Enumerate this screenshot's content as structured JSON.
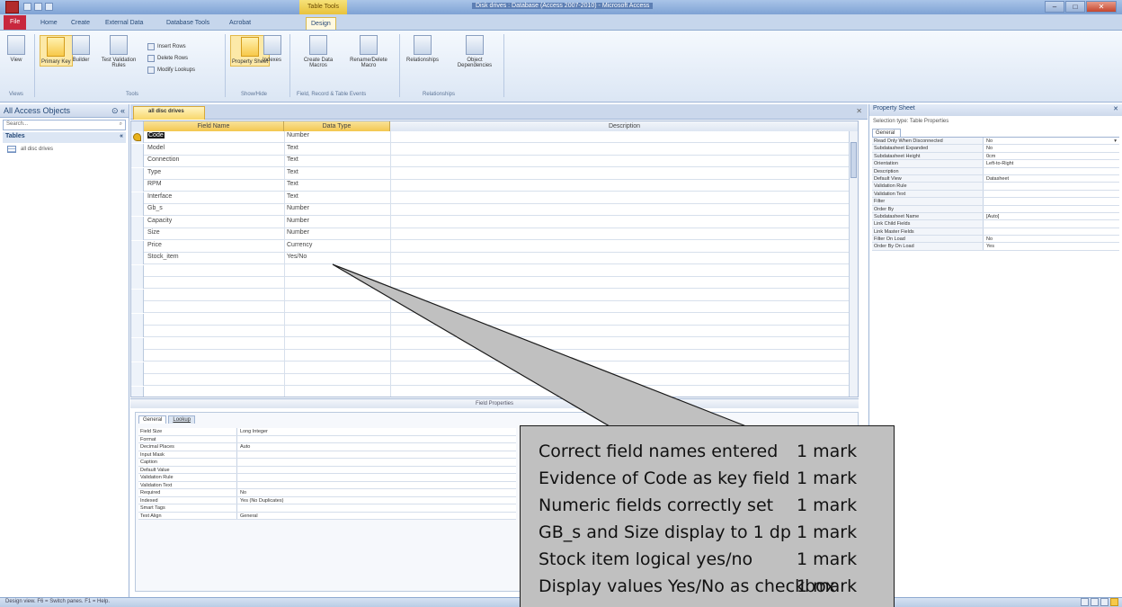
{
  "window": {
    "title": "Disk drives : Database (Access 2007-2010) - Microsoft Access",
    "context_tab_header": "Table Tools",
    "controls": {
      "minimize": "–",
      "maximize": "□",
      "close": "✕"
    }
  },
  "ribbon": {
    "tabs": [
      "File",
      "Home",
      "Create",
      "External Data",
      "Database Tools",
      "Acrobat",
      "Design"
    ],
    "active_tab": "Design",
    "buttons": {
      "view": "View",
      "primary_key": "Primary Key",
      "builder": "Builder",
      "test_validation": "Test Validation Rules",
      "insert_rows": "Insert Rows",
      "delete_rows": "Delete Rows",
      "modify_lookups": "Modify Lookups",
      "property_sheet": "Property Sheet",
      "indexes": "Indexes",
      "create_data_macros": "Create Data Macros",
      "rename_delete_macro": "Rename/Delete Macro",
      "relationships": "Relationships",
      "object_dependencies": "Object Dependencies"
    },
    "groups": [
      "Views",
      "Tools",
      "Show/Hide",
      "Field, Record & Table Events",
      "Relationships"
    ]
  },
  "nav_pane": {
    "header": "All Access Objects",
    "search_placeholder": "Search...",
    "group": "Tables",
    "items": [
      "all disc drives"
    ]
  },
  "document": {
    "tab_label": "all disc drives",
    "columns": [
      "Field Name",
      "Data Type",
      "Description"
    ],
    "fields": [
      {
        "name": "Code",
        "type": "Number"
      },
      {
        "name": "Model",
        "type": "Text"
      },
      {
        "name": "Connection",
        "type": "Text"
      },
      {
        "name": "Type",
        "type": "Text"
      },
      {
        "name": "RPM",
        "type": "Text"
      },
      {
        "name": "Interface",
        "type": "Text"
      },
      {
        "name": "Gb_s",
        "type": "Number"
      },
      {
        "name": "Capacity",
        "type": "Number"
      },
      {
        "name": "Size",
        "type": "Number"
      },
      {
        "name": "Price",
        "type": "Currency"
      },
      {
        "name": "Stock_item",
        "type": "Yes/No"
      }
    ],
    "field_properties_label": "Field Properties",
    "fp_tabs": [
      "General",
      "Lookup"
    ],
    "field_properties": [
      {
        "name": "Field Size",
        "value": "Long Integer"
      },
      {
        "name": "Format",
        "value": ""
      },
      {
        "name": "Decimal Places",
        "value": "Auto"
      },
      {
        "name": "Input Mask",
        "value": ""
      },
      {
        "name": "Caption",
        "value": ""
      },
      {
        "name": "Default Value",
        "value": ""
      },
      {
        "name": "Validation Rule",
        "value": ""
      },
      {
        "name": "Validation Text",
        "value": ""
      },
      {
        "name": "Required",
        "value": "No"
      },
      {
        "name": "Indexed",
        "value": "Yes (No Duplicates)"
      },
      {
        "name": "Smart Tags",
        "value": ""
      },
      {
        "name": "Text Align",
        "value": "General"
      }
    ]
  },
  "property_sheet": {
    "header": "Property Sheet",
    "selection_type": "Selection type: Table Properties",
    "tab": "General",
    "rows": [
      {
        "name": "Read Only When Disconnected",
        "value": "No"
      },
      {
        "name": "Subdatasheet Expanded",
        "value": "No"
      },
      {
        "name": "Subdatasheet Height",
        "value": "0cm"
      },
      {
        "name": "Orientation",
        "value": "Left-to-Right"
      },
      {
        "name": "Description",
        "value": ""
      },
      {
        "name": "Default View",
        "value": "Datasheet"
      },
      {
        "name": "Validation Rule",
        "value": ""
      },
      {
        "name": "Validation Text",
        "value": ""
      },
      {
        "name": "Filter",
        "value": ""
      },
      {
        "name": "Order By",
        "value": ""
      },
      {
        "name": "Subdatasheet Name",
        "value": "[Auto]"
      },
      {
        "name": "Link Child Fields",
        "value": ""
      },
      {
        "name": "Link Master Fields",
        "value": ""
      },
      {
        "name": "Filter On Load",
        "value": "No"
      },
      {
        "name": "Order By On Load",
        "value": "Yes"
      }
    ]
  },
  "status_bar": {
    "text": "Design view. F6 = Switch panes. F1 = Help."
  },
  "callout": {
    "criteria": [
      {
        "text": "Correct field names entered",
        "mark": "1 mark"
      },
      {
        "text": "Evidence of Code as key field",
        "mark": "1 mark"
      },
      {
        "text": "Numeric fields correctly set",
        "mark": "1 mark"
      },
      {
        "text": "GB_s and Size display to 1 dp",
        "mark": "1 mark"
      },
      {
        "text": "Stock item logical yes/no",
        "mark": "1 mark"
      },
      {
        "text": "Display values Yes/No as checkbox",
        "mark": "1 mark"
      }
    ]
  },
  "colors": {
    "callout_fill": "#c0c0c0",
    "file_tab": "#c8273e",
    "context_tab": "#f4c750",
    "title_bar": "#7ea2d4"
  }
}
